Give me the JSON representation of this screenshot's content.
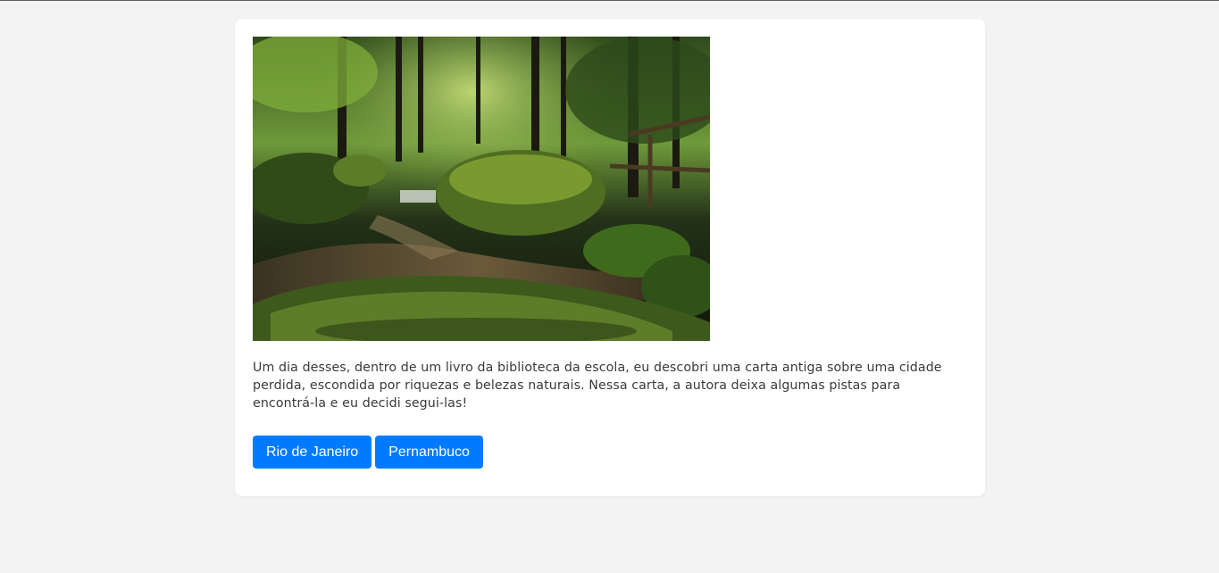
{
  "story": {
    "paragraph": "Um dia desses, dentro de um livro da biblioteca da escola, eu descobri uma carta antiga sobre uma cidade perdida, escondida por riquezas e belezas naturais. Nessa carta, a autora deixa algumas pistas para encontrá-la e eu decidi segui-las!"
  },
  "choices": [
    {
      "label": "Rio de Janeiro"
    },
    {
      "label": "Pernambuco"
    }
  ],
  "colors": {
    "background": "#f3f3f3",
    "card": "#ffffff",
    "button": "#007bff",
    "button_text": "#ffffff",
    "text": "#3a3a3a"
  }
}
